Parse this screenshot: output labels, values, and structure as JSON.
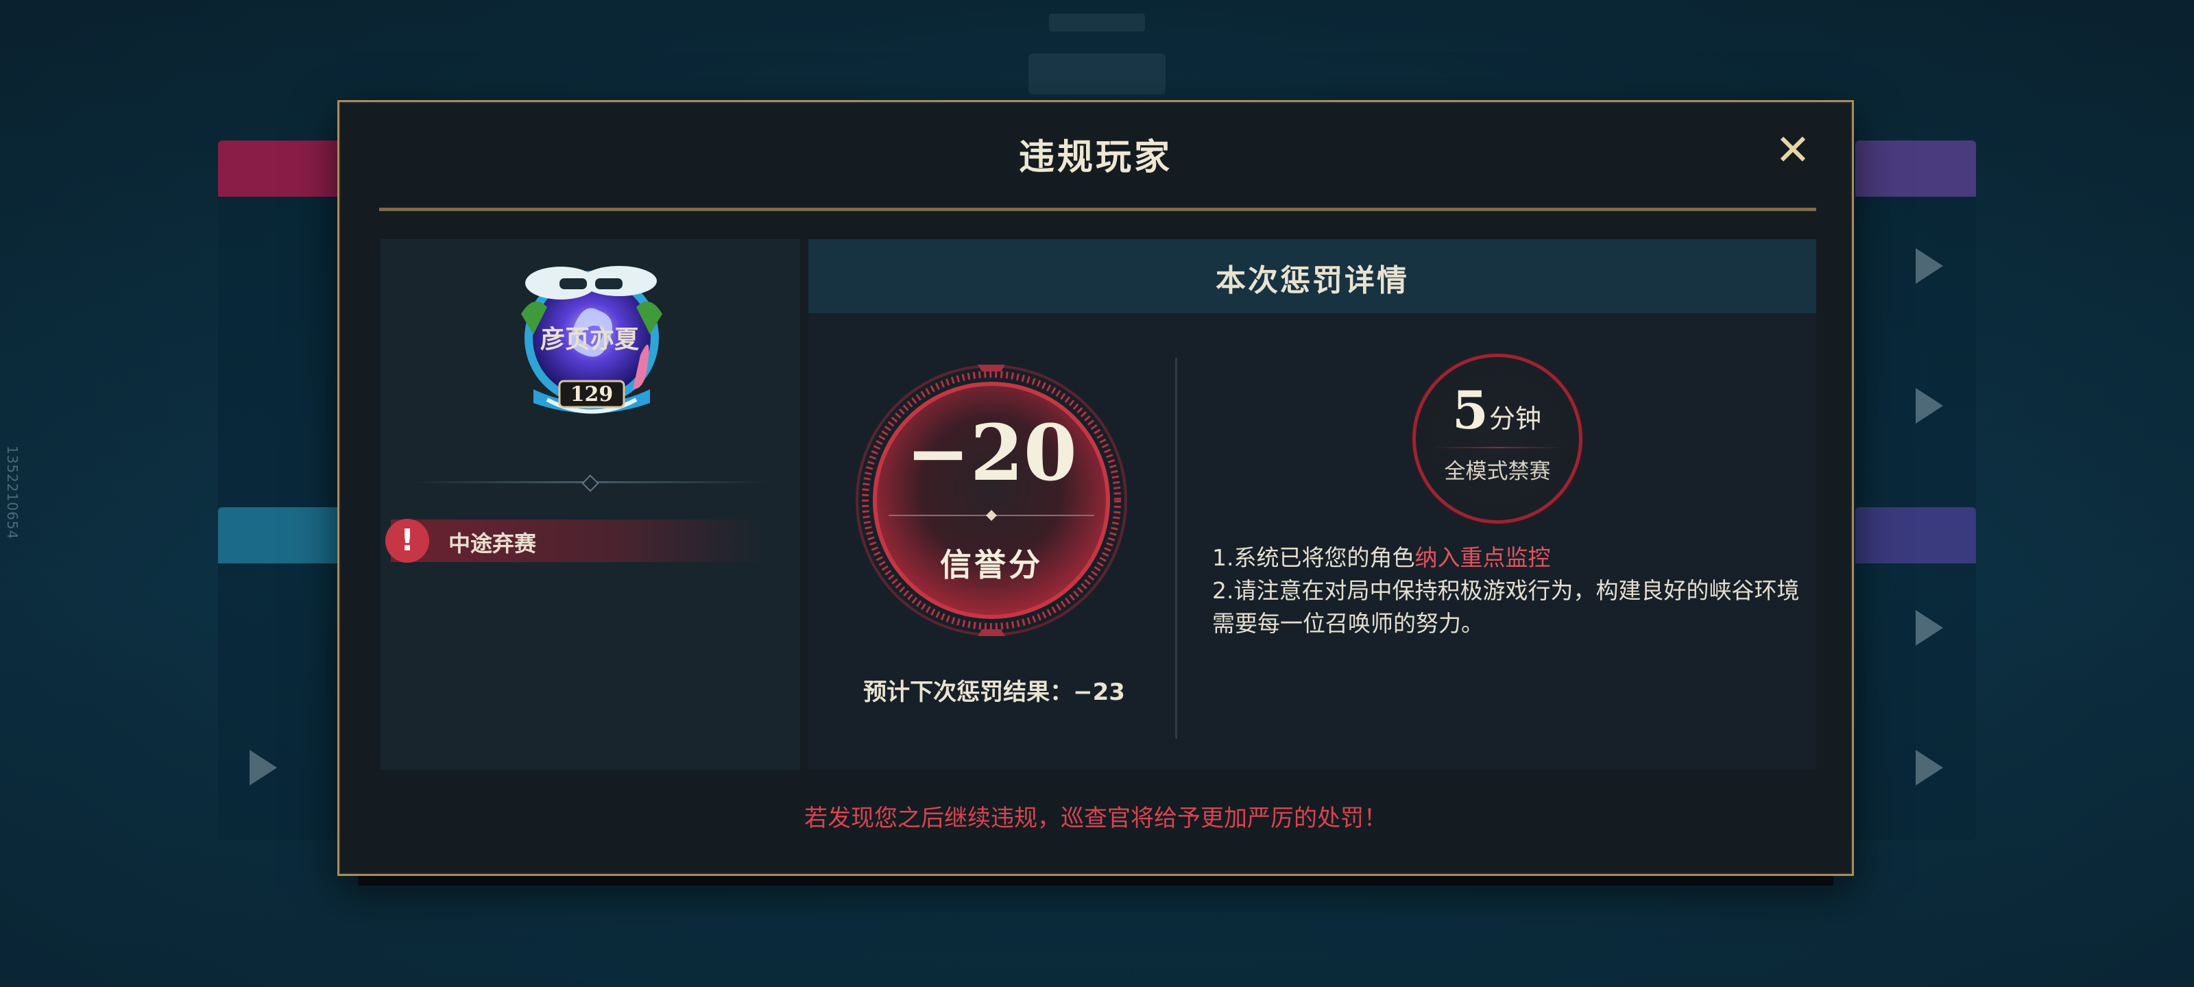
{
  "background": {
    "side_id": "1352210654"
  },
  "modal": {
    "title": "违规玩家",
    "close_symbol": "✕",
    "player": {
      "name": "彦页亦夏",
      "level": "129",
      "violation": "中途弃赛",
      "warn_symbol": "!"
    },
    "details": {
      "header": "本次惩罚详情",
      "credit_change": "−20",
      "credit_label": "信誉分",
      "next_result_label": "预计下次惩罚结果：",
      "next_result_value": "−23",
      "ban_duration": "5",
      "ban_unit": "分钟",
      "ban_mode": "全模式禁赛",
      "note1_prefix": "1.系统已将您的角色",
      "note1_highlight": "纳入重点监控",
      "note2": "2.请注意在对局中保持积极游戏行为，构建良好的峡谷环境需要每一位召唤师的努力。"
    },
    "footer_warning": "若发现您之后继续违规，巡查官将给予更加严厉的处罚！"
  },
  "colors": {
    "gold_border": "#a98d58",
    "accent_red": "#d9444f",
    "panel_bg": "#141c22"
  }
}
